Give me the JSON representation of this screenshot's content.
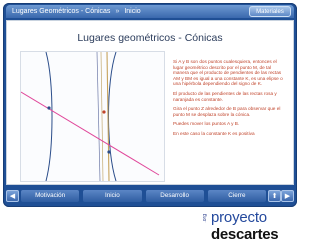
{
  "header": {
    "title": "Lugares Geométricos - Cónicas",
    "separator": "»",
    "crumb": "Inicio",
    "mat_button": "Materiales"
  },
  "scene": {
    "title": "Lugares geométricos - Cónicas",
    "paragraphs": [
      "Si A y B son dos puntos cualesquiera, entonces el lugar geométrico descrito por el punto M, de tal manera que el producto de pendientes de las rectas AM y BM es igual a una constante K, es una elipse o una hipérbola dependiendo del signo de K.",
      "El producto de las pendientes de las rectas rosa y naranjada es constante.",
      "Gira el punto Z alrededor de B para observar que el punto M se desplaza sobre la cónica.",
      "Puedes mover los puntos A y B.",
      "En este caso la constante K es positiva"
    ]
  },
  "nav": {
    "prev": "◀",
    "next": "▶",
    "up": "⬆",
    "tabs": [
      "Motivación",
      "Inicio",
      "Desarrollo",
      "Cierre"
    ]
  },
  "logo": {
    "org": ".org",
    "word1": "proyecto",
    "word2": "descartes"
  },
  "icons": {
    "prev": "left-arrow-icon",
    "next": "right-arrow-icon",
    "up": "up-arrow-icon"
  },
  "colors": {
    "frame": "#1f4f95",
    "text": "#c0442b",
    "pink_line": "#e0479a",
    "orange_line": "#c7a35c",
    "conic": "#2b4d8a"
  }
}
